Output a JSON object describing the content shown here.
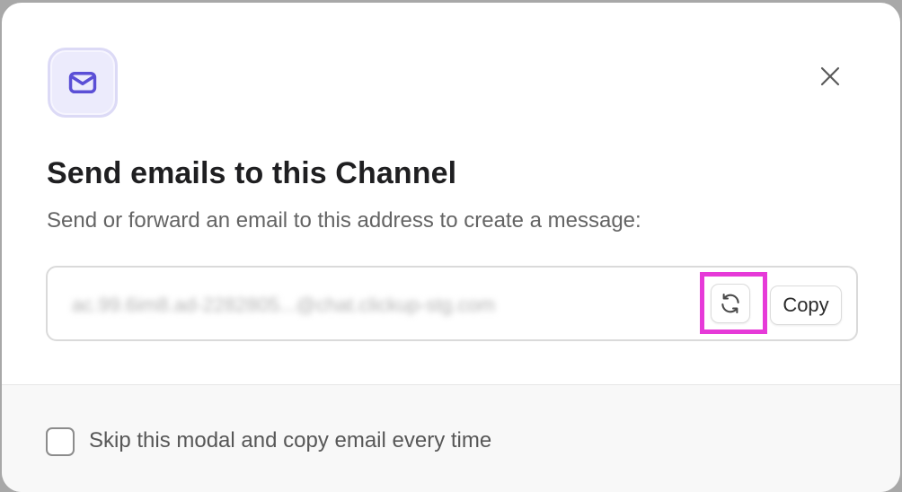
{
  "modal": {
    "header_icon": "envelope-icon",
    "close_icon": "close-icon",
    "title": "Send emails to this Channel",
    "subtitle": "Send or forward an email to this address to create a message:"
  },
  "email_field": {
    "value": "ac.99.6im8.ad-2282805...@chat.clickup-stg.com",
    "refresh_icon": "refresh-icon",
    "copy_label": "Copy"
  },
  "footer": {
    "checkbox_checked": false,
    "checkbox_label": "Skip this modal and copy email every time"
  },
  "colors": {
    "accent": "#5b4fd6",
    "icon_badge_bg": "#ecebfc",
    "highlight": "#e63ad8"
  }
}
